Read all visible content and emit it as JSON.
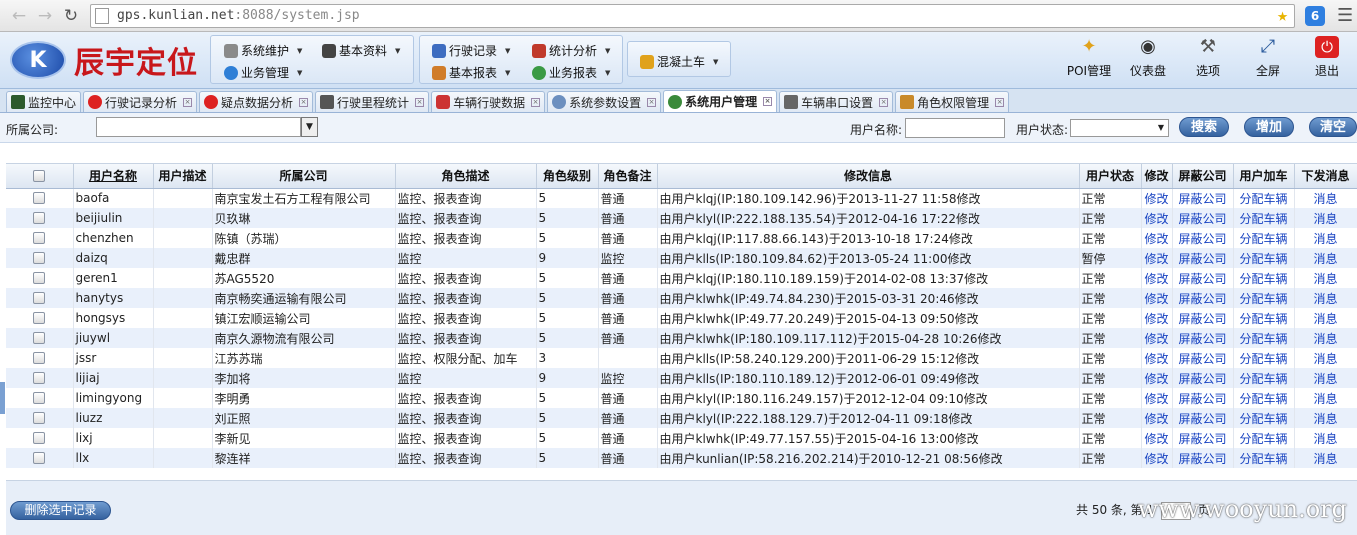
{
  "browser": {
    "url_host": "gps.kunlian.net",
    "url_rest": ":8088/system.jsp"
  },
  "app": {
    "logo_text": "辰宇定位",
    "menus": [
      {
        "label": "系统维护",
        "icon_color": "#7a7a7a"
      },
      {
        "label": "基本资料",
        "icon_color": "#444444"
      },
      {
        "label": "业务管理",
        "icon_color": "#2f7fd6"
      },
      {
        "label": "行驶记录",
        "icon_color": "#3d6cc0"
      },
      {
        "label": "统计分析",
        "icon_color": "#c0392b"
      },
      {
        "label": "基本报表",
        "icon_color": "#d07c2a"
      },
      {
        "label": "业务报表",
        "icon_color": "#3a9a45"
      },
      {
        "label": "混凝土车",
        "icon_color": "#e0a21c"
      }
    ],
    "tools": [
      {
        "label": "POI管理",
        "icon": "pin-icon"
      },
      {
        "label": "仪表盘",
        "icon": "dashboard-icon"
      },
      {
        "label": "选项",
        "icon": "tools-icon"
      },
      {
        "label": "全屏",
        "icon": "fullscreen-icon"
      },
      {
        "label": "退出",
        "icon": "power-icon"
      }
    ]
  },
  "tabs": [
    {
      "label": "监控中心",
      "closable": false
    },
    {
      "label": "行驶记录分析",
      "closable": true
    },
    {
      "label": "疑点数据分析",
      "closable": true
    },
    {
      "label": "行驶里程统计",
      "closable": true
    },
    {
      "label": "车辆行驶数据",
      "closable": true
    },
    {
      "label": "系统参数设置",
      "closable": true
    },
    {
      "label": "系统用户管理",
      "closable": true,
      "active": true
    },
    {
      "label": "车辆串口设置",
      "closable": true
    },
    {
      "label": "角色权限管理",
      "closable": true
    }
  ],
  "search": {
    "company_label": "所属公司:",
    "username_label": "用户名称:",
    "status_label": "用户状态:",
    "search_btn": "搜索",
    "add_btn": "增加",
    "clear_btn": "清空"
  },
  "table": {
    "headers": [
      "用户名称",
      "用户描述",
      "所属公司",
      "角色描述",
      "角色级别",
      "角色备注",
      "修改信息",
      "用户状态",
      "修改",
      "屏蔽公司",
      "用户加车",
      "下发消息"
    ],
    "rows": [
      [
        "baofa",
        "",
        "南京宝发土石方工程有限公司",
        "监控、报表查询",
        "5",
        "普通",
        "由用户klqj(IP:180.109.142.96)于2013-11-27 11:58修改",
        "正常",
        "修改",
        "屏蔽公司",
        "分配车辆",
        "消息"
      ],
      [
        "beijiulin",
        "",
        "贝玖琳",
        "监控、报表查询",
        "5",
        "普通",
        "由用户klyl(IP:222.188.135.54)于2012-04-16 17:22修改",
        "正常",
        "修改",
        "屏蔽公司",
        "分配车辆",
        "消息"
      ],
      [
        "chenzhen",
        "",
        "陈镇（苏瑞）",
        "监控、报表查询",
        "5",
        "普通",
        "由用户klqj(IP:117.88.66.143)于2013-10-18 17:24修改",
        "正常",
        "修改",
        "屏蔽公司",
        "分配车辆",
        "消息"
      ],
      [
        "daizq",
        "",
        "戴忠群",
        "监控",
        "9",
        "监控",
        "由用户klls(IP:180.109.84.62)于2013-05-24 11:00修改",
        "暂停",
        "修改",
        "屏蔽公司",
        "分配车辆",
        "消息"
      ],
      [
        "geren1",
        "",
        "苏AG5520",
        "监控、报表查询",
        "5",
        "普通",
        "由用户klqj(IP:180.110.189.159)于2014-02-08 13:37修改",
        "正常",
        "修改",
        "屏蔽公司",
        "分配车辆",
        "消息"
      ],
      [
        "hanytys",
        "",
        "南京畅奕通运输有限公司",
        "监控、报表查询",
        "5",
        "普通",
        "由用户klwhk(IP:49.74.84.230)于2015-03-31 20:46修改",
        "正常",
        "修改",
        "屏蔽公司",
        "分配车辆",
        "消息"
      ],
      [
        "hongsys",
        "",
        "镇江宏顺运输公司",
        "监控、报表查询",
        "5",
        "普通",
        "由用户klwhk(IP:49.77.20.249)于2015-04-13 09:50修改",
        "正常",
        "修改",
        "屏蔽公司",
        "分配车辆",
        "消息"
      ],
      [
        "jiuywl",
        "",
        "南京久源物流有限公司",
        "监控、报表查询",
        "5",
        "普通",
        "由用户klwhk(IP:180.109.117.112)于2015-04-28 10:26修改",
        "正常",
        "修改",
        "屏蔽公司",
        "分配车辆",
        "消息"
      ],
      [
        "jssr",
        "",
        "江苏苏瑞",
        "监控、权限分配、加车",
        "3",
        "",
        "由用户klls(IP:58.240.129.200)于2011-06-29 15:12修改",
        "正常",
        "修改",
        "屏蔽公司",
        "分配车辆",
        "消息"
      ],
      [
        "lijiaj",
        "",
        "李加将",
        "监控",
        "9",
        "监控",
        "由用户klls(IP:180.110.189.12)于2012-06-01 09:49修改",
        "正常",
        "修改",
        "屏蔽公司",
        "分配车辆",
        "消息"
      ],
      [
        "limingyong",
        "",
        "李明勇",
        "监控、报表查询",
        "5",
        "普通",
        "由用户klyl(IP:180.116.249.157)于2012-12-04 09:10修改",
        "正常",
        "修改",
        "屏蔽公司",
        "分配车辆",
        "消息"
      ],
      [
        "liuzz",
        "",
        "刘正照",
        "监控、报表查询",
        "5",
        "普通",
        "由用户klyl(IP:222.188.129.7)于2012-04-11 09:18修改",
        "正常",
        "修改",
        "屏蔽公司",
        "分配车辆",
        "消息"
      ],
      [
        "lixj",
        "",
        "李新见",
        "监控、报表查询",
        "5",
        "普通",
        "由用户klwhk(IP:49.77.157.55)于2015-04-16 13:00修改",
        "正常",
        "修改",
        "屏蔽公司",
        "分配车辆",
        "消息"
      ],
      [
        "llx",
        "",
        "黎连祥",
        "监控、报表查询",
        "5",
        "普通",
        "由用户kunlian(IP:58.216.202.214)于2010-12-21 08:56修改",
        "正常",
        "修改",
        "屏蔽公司",
        "分配车辆",
        "消息"
      ]
    ]
  },
  "footer": {
    "delete_btn": "删除选中记录",
    "pager_text": "共 50 条, 第 1",
    "pager_tail": "页",
    "watermark": "www.wooyun.org"
  },
  "colors": {
    "link": "#1843c2",
    "button": "#35629f",
    "header_bg": "#cfe0f4",
    "row_alt": "#e9f0fb"
  }
}
